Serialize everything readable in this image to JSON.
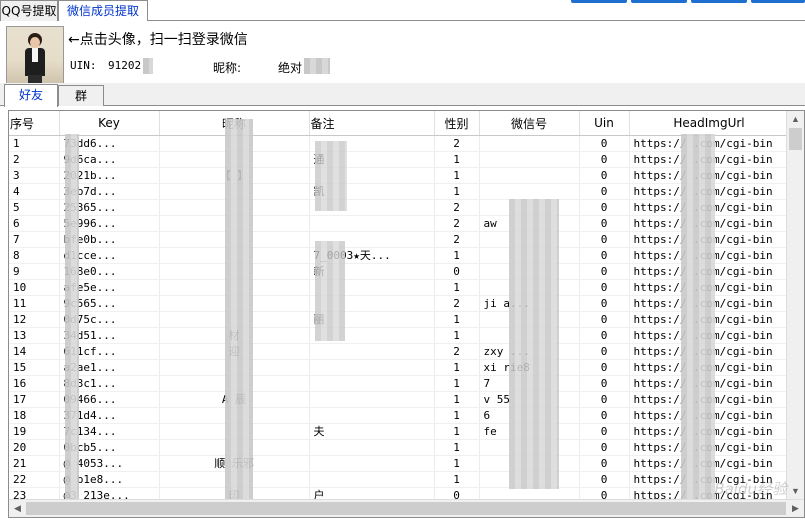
{
  "top_tabs": [
    {
      "label": "QQ号提取",
      "active": false
    },
    {
      "label": "微信成员提取",
      "active": true
    }
  ],
  "profile": {
    "hint": "←点击头像，扫一扫登录微信",
    "uin_label": "UIN:",
    "uin_value": "91202",
    "nick_label": "昵称:",
    "nick_value": "绝对"
  },
  "sub_tabs": [
    {
      "label": "好友",
      "active": true
    },
    {
      "label": "群",
      "active": false
    }
  ],
  "table": {
    "columns": [
      "序号",
      "Key",
      "昵称",
      "备注",
      "性别",
      "微信号",
      "Uin",
      "HeadImgUrl"
    ],
    "rows": [
      [
        "1",
        "73dd6...",
        "",
        "",
        "2",
        "",
        "0",
        "https:// .com/cgi-bin"
      ],
      [
        "2",
        "9d6ca...",
        "",
        "通",
        "1",
        "",
        "0",
        "https:// .com/cgi-bin"
      ],
      [
        "3",
        "2021b...",
        "【 】",
        "",
        "1",
        "",
        "0",
        "https:// .com/cgi-bin"
      ],
      [
        "4",
        "3eb7d...",
        "",
        "凯",
        "1",
        "",
        "0",
        "https:// .com/cgi-bin"
      ],
      [
        "5",
        "25365...",
        "",
        "",
        "2",
        "",
        "0",
        "https:// .com/cgi-bin"
      ],
      [
        "6",
        "5e996...",
        "",
        "",
        "2",
        "aw",
        "0",
        "https:// .com/cgi-bin"
      ],
      [
        "7",
        "bfe0b...",
        "",
        "",
        "2",
        "",
        "0",
        "https:// .com/cgi-bin"
      ],
      [
        "8",
        "d1cce...",
        "",
        "7_0003★天...",
        "1",
        "",
        "0",
        "https:// .com/cgi-bin"
      ],
      [
        "9",
        "168e0...",
        "",
        "新",
        "0",
        "",
        "0",
        "https:// .com/cgi-bin"
      ],
      [
        "10",
        "afe5e...",
        "",
        "",
        "1",
        "",
        "0",
        "https:// .com/cgi-bin"
      ],
      [
        "11",
        "9c565...",
        "",
        "",
        "2",
        "ji a...",
        "0",
        "https:// .com/cgi-bin"
      ],
      [
        "12",
        "0d75c...",
        "",
        "丽",
        "1",
        "",
        "0",
        "https:// .com/cgi-bin"
      ],
      [
        "13",
        "34d51...",
        "材",
        "",
        "1",
        "",
        "0",
        "https:// .com/cgi-bin"
      ],
      [
        "14",
        "611cf...",
        "迎",
        "",
        "2",
        "zxy ...",
        "0",
        "https:// .com/cgi-bin"
      ],
      [
        "15",
        "a2ae1...",
        "",
        "",
        "1",
        "xi rie8",
        "0",
        "https:// .com/cgi-bin"
      ],
      [
        "16",
        "8d3c1...",
        "",
        "",
        "1",
        "7",
        "0",
        "https:// .com/cgi-bin"
      ],
      [
        "17",
        "09466...",
        "A 辰",
        "",
        "1",
        "v 55",
        "0",
        "https:// .com/cgi-bin"
      ],
      [
        "18",
        "371d4...",
        "",
        "",
        "1",
        "6",
        "0",
        "https:// .com/cgi-bin"
      ],
      [
        "19",
        "7c134...",
        "",
        "夫",
        "1",
        "fe",
        "0",
        "https:// .com/cgi-bin"
      ],
      [
        "20",
        "0bcb5...",
        "",
        "",
        "1",
        "",
        "0",
        "https:// .com/cgi-bin"
      ],
      [
        "21",
        "@ 4053...",
        "顺 乐邪",
        "",
        "1",
        "",
        "0",
        "https:// .com/cgi-bin"
      ],
      [
        "22",
        "@ b1e8...",
        "",
        "",
        "1",
        "",
        "0",
        "https:// .com/cgi-bin"
      ],
      [
        "23",
        "@3 213e...",
        "印",
        "户",
        "0",
        "",
        "0",
        "https:// .com/cgi-bin"
      ]
    ]
  },
  "watermark": "Baidu经验"
}
